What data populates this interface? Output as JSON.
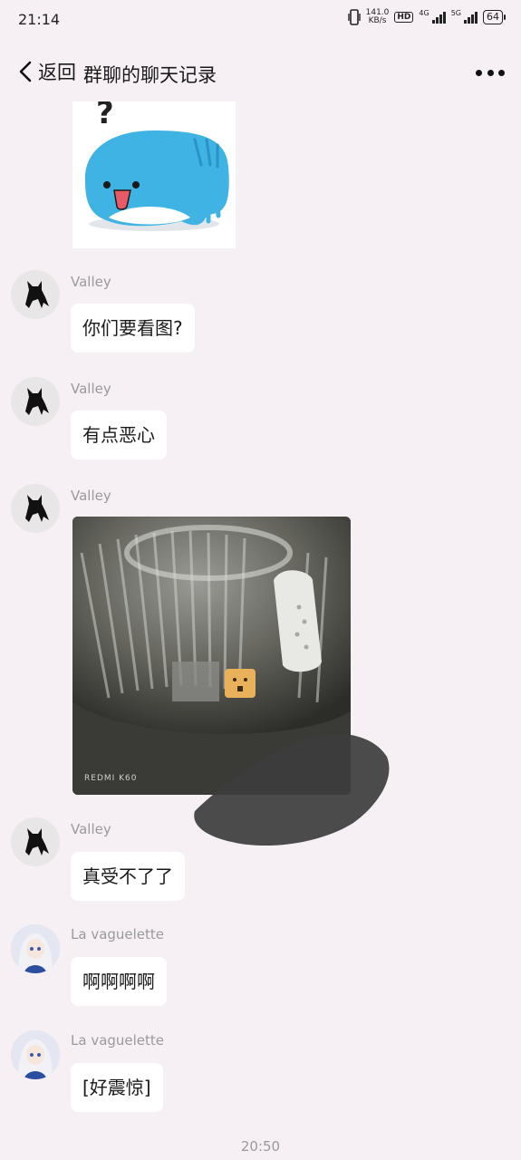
{
  "status_bar": {
    "time": "21:14",
    "net_speed_value": "141.0",
    "net_speed_unit": "KB/s",
    "hd_label": "HD",
    "sim1_label": "4G",
    "sim2_label": "5G",
    "battery": "64"
  },
  "header": {
    "back_label": "返回",
    "title": "群聊的聊天记录"
  },
  "messages": [
    {
      "sender": "Valley",
      "text": "你们要看图?"
    },
    {
      "sender": "Valley",
      "text": "有点恶心"
    },
    {
      "sender": "Valley",
      "photo_caption": "REDMI K60"
    },
    {
      "sender": "Valley",
      "text": "真受不了了"
    },
    {
      "sender": "La vaguelette",
      "text": "啊啊啊啊"
    },
    {
      "sender": "La vaguelette",
      "text": "[好震惊]"
    }
  ],
  "footer": {
    "timestamp": "20:50"
  }
}
